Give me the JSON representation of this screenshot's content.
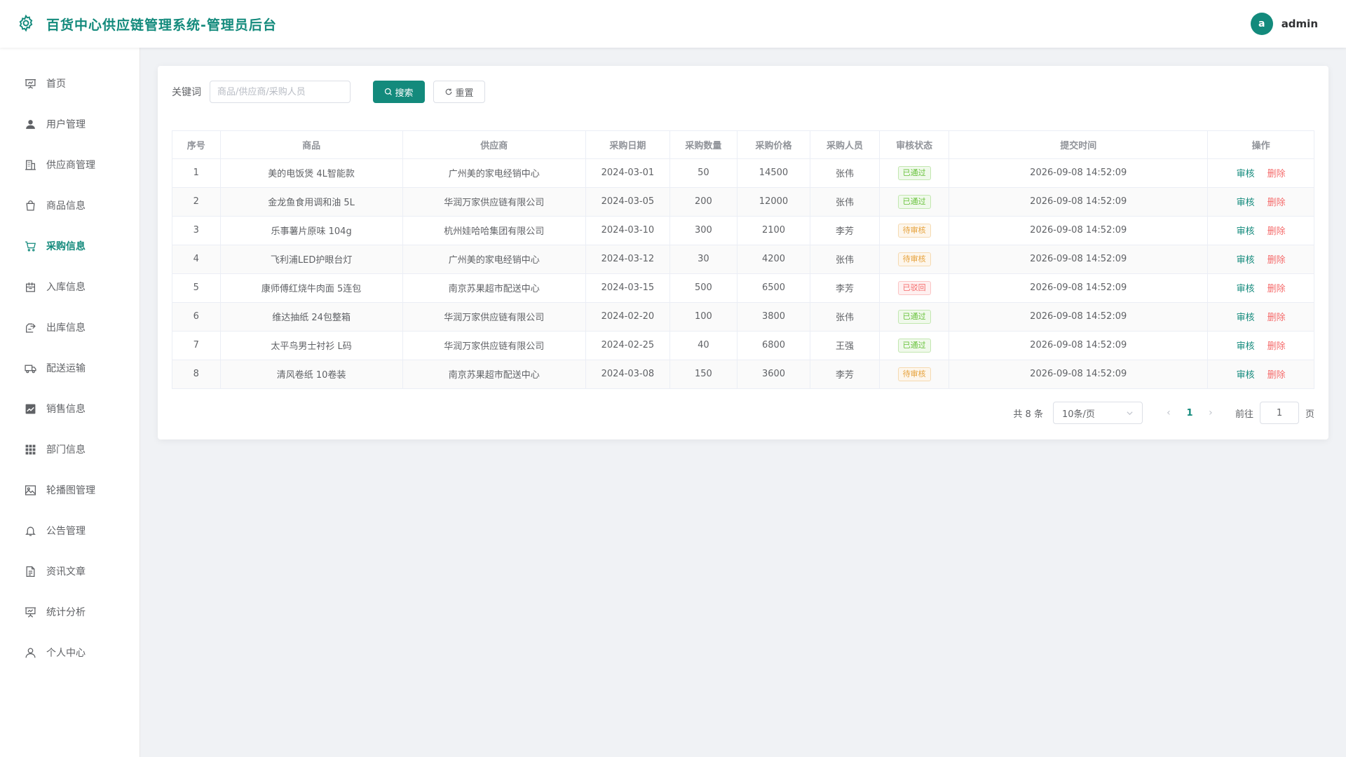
{
  "header": {
    "title": "百货中心供应链管理系统-管理员后台",
    "avatar_letter": "a",
    "username": "admin"
  },
  "sidebar": {
    "items": [
      {
        "label": "首页",
        "icon": "presentation-icon",
        "active": false
      },
      {
        "label": "用户管理",
        "icon": "user-filled-icon",
        "active": false
      },
      {
        "label": "供应商管理",
        "icon": "building-icon",
        "active": false
      },
      {
        "label": "商品信息",
        "icon": "shopping-bag-icon",
        "active": false
      },
      {
        "label": "采购信息",
        "icon": "shopping-cart-icon",
        "active": true
      },
      {
        "label": "入库信息",
        "icon": "inbox-in-icon",
        "active": false
      },
      {
        "label": "出库信息",
        "icon": "inbox-out-icon",
        "active": false
      },
      {
        "label": "配送运输",
        "icon": "truck-icon",
        "active": false
      },
      {
        "label": "销售信息",
        "icon": "trend-chart-icon",
        "active": false
      },
      {
        "label": "部门信息",
        "icon": "grid-icon",
        "active": false
      },
      {
        "label": "轮播图管理",
        "icon": "picture-icon",
        "active": false
      },
      {
        "label": "公告管理",
        "icon": "bell-icon",
        "active": false
      },
      {
        "label": "资讯文章",
        "icon": "document-icon",
        "active": false
      },
      {
        "label": "统计分析",
        "icon": "data-board-icon",
        "active": false
      },
      {
        "label": "个人中心",
        "icon": "user-outline-icon",
        "active": false
      }
    ]
  },
  "search": {
    "label": "关键词",
    "placeholder": "商品/供应商/采购人员",
    "value": "",
    "search_button": "搜索",
    "reset_button": "重置"
  },
  "table": {
    "columns": [
      "序号",
      "商品",
      "供应商",
      "采购日期",
      "采购数量",
      "采购价格",
      "采购人员",
      "审核状态",
      "提交时间",
      "操作"
    ],
    "rows": [
      {
        "index": "1",
        "product": "美的电饭煲 4L智能款",
        "supplier": "广州美的家电经销中心",
        "date": "2024-03-01",
        "qty": "50",
        "price": "14500",
        "buyer": "张伟",
        "status": "已通过",
        "status_type": "success",
        "submit_time": "2026-09-08 14:52:09"
      },
      {
        "index": "2",
        "product": "金龙鱼食用调和油 5L",
        "supplier": "华润万家供应链有限公司",
        "date": "2024-03-05",
        "qty": "200",
        "price": "12000",
        "buyer": "张伟",
        "status": "已通过",
        "status_type": "success",
        "submit_time": "2026-09-08 14:52:09"
      },
      {
        "index": "3",
        "product": "乐事薯片原味 104g",
        "supplier": "杭州娃哈哈集团有限公司",
        "date": "2024-03-10",
        "qty": "300",
        "price": "2100",
        "buyer": "李芳",
        "status": "待审核",
        "status_type": "warning",
        "submit_time": "2026-09-08 14:52:09"
      },
      {
        "index": "4",
        "product": "飞利浦LED护眼台灯",
        "supplier": "广州美的家电经销中心",
        "date": "2024-03-12",
        "qty": "30",
        "price": "4200",
        "buyer": "张伟",
        "status": "待审核",
        "status_type": "warning",
        "submit_time": "2026-09-08 14:52:09"
      },
      {
        "index": "5",
        "product": "康师傅红烧牛肉面 5连包",
        "supplier": "南京苏果超市配送中心",
        "date": "2024-03-15",
        "qty": "500",
        "price": "6500",
        "buyer": "李芳",
        "status": "已驳回",
        "status_type": "danger",
        "submit_time": "2026-09-08 14:52:09"
      },
      {
        "index": "6",
        "product": "维达抽纸 24包整箱",
        "supplier": "华润万家供应链有限公司",
        "date": "2024-02-20",
        "qty": "100",
        "price": "3800",
        "buyer": "张伟",
        "status": "已通过",
        "status_type": "success",
        "submit_time": "2026-09-08 14:52:09"
      },
      {
        "index": "7",
        "product": "太平鸟男士衬衫 L码",
        "supplier": "华润万家供应链有限公司",
        "date": "2024-02-25",
        "qty": "40",
        "price": "6800",
        "buyer": "王强",
        "status": "已通过",
        "status_type": "success",
        "submit_time": "2026-09-08 14:52:09"
      },
      {
        "index": "8",
        "product": "清风卷纸 10卷装",
        "supplier": "南京苏果超市配送中心",
        "date": "2024-03-08",
        "qty": "150",
        "price": "3600",
        "buyer": "李芳",
        "status": "待审核",
        "status_type": "warning",
        "submit_time": "2026-09-08 14:52:09"
      }
    ],
    "actions": {
      "audit": "审核",
      "delete": "删除"
    }
  },
  "pagination": {
    "total_text": "共 8 条",
    "page_size": "10条/页",
    "current_page": "1",
    "goto_label": "前往",
    "goto_value": "1",
    "goto_suffix": "页"
  },
  "colors": {
    "accent": "#138a7c",
    "success": "#67c23a",
    "warning": "#e6a23c",
    "danger": "#f56c6c"
  }
}
